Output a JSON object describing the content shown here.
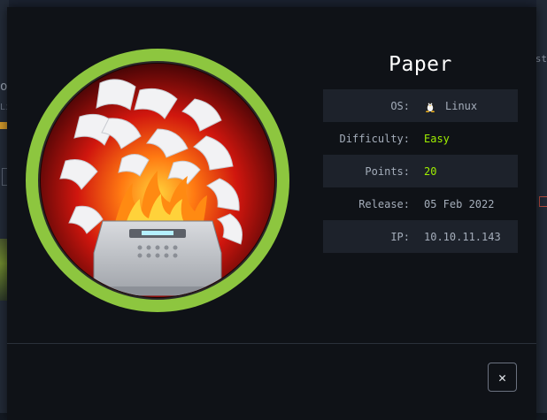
{
  "background": {
    "left_fragment": "o",
    "left_fragment_small": "Li",
    "right_fragment": "st"
  },
  "machine": {
    "name": "Paper",
    "avatar_icon": "burning-paper-printer",
    "ring_color": "#8dc63f",
    "rows": [
      {
        "label": "OS:",
        "value": "Linux",
        "icon": "tux-icon",
        "accent": false
      },
      {
        "label": "Difficulty:",
        "value": "Easy",
        "accent": true
      },
      {
        "label": "Points:",
        "value": "20",
        "accent": true
      },
      {
        "label": "Release:",
        "value": "05 Feb 2022",
        "accent": false
      },
      {
        "label": "IP:",
        "value": "10.10.11.143",
        "accent": false
      }
    ]
  },
  "close_button": {
    "label": "✕"
  }
}
